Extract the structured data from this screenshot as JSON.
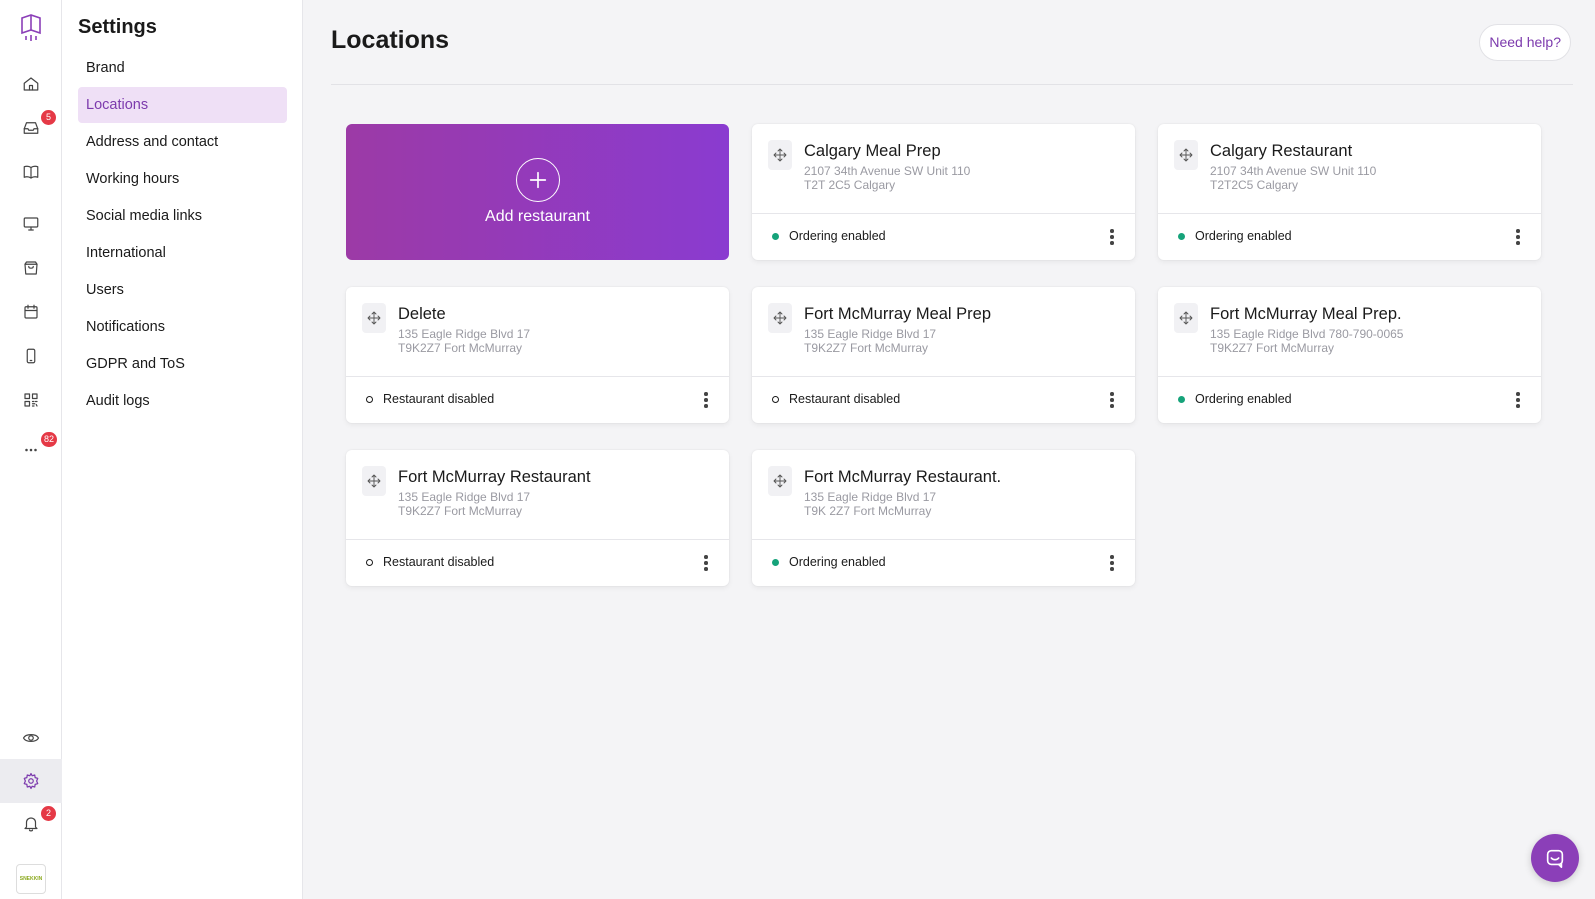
{
  "rail": {
    "inbox_badge": "5",
    "more_badge": "82",
    "notifications_badge": "2",
    "avatar_text": "SNEKKIN",
    "icons": [
      "logo-icon",
      "home-icon",
      "inbox-icon",
      "book-icon",
      "monitor-icon",
      "shopping-bag-icon",
      "calendar-icon",
      "mobile-icon",
      "qr-code-icon",
      "more-icon",
      "eye-icon",
      "gear-icon",
      "bell-icon"
    ]
  },
  "settings": {
    "title": "Settings",
    "items": [
      {
        "label": "Brand"
      },
      {
        "label": "Locations"
      },
      {
        "label": "Address and contact"
      },
      {
        "label": "Working hours"
      },
      {
        "label": "Social media links"
      },
      {
        "label": "International"
      },
      {
        "label": "Users"
      },
      {
        "label": "Notifications"
      },
      {
        "label": "GDPR and ToS"
      },
      {
        "label": "Audit logs"
      }
    ],
    "active_index": 1
  },
  "main": {
    "title": "Locations",
    "help_label": "Need help?",
    "add_label": "Add restaurant",
    "locations": [
      {
        "name": "Calgary Meal Prep",
        "address_line1": "2107 34th Avenue SW Unit 110",
        "address_line2": "T2T 2C5 Calgary",
        "status": "Ordering enabled",
        "enabled": true
      },
      {
        "name": "Calgary Restaurant",
        "address_line1": "2107 34th Avenue SW Unit 110",
        "address_line2": "T2T2C5 Calgary",
        "status": "Ordering enabled",
        "enabled": true
      },
      {
        "name": "Delete",
        "address_line1": "135 Eagle Ridge Blvd 17",
        "address_line2": "T9K2Z7 Fort McMurray",
        "status": "Restaurant disabled",
        "enabled": false
      },
      {
        "name": "Fort McMurray Meal Prep",
        "address_line1": "135 Eagle Ridge Blvd 17",
        "address_line2": "T9K2Z7 Fort McMurray",
        "status": "Restaurant disabled",
        "enabled": false
      },
      {
        "name": "Fort McMurray Meal Prep.",
        "address_line1": "135 Eagle Ridge Blvd 780-790-0065",
        "address_line2": "T9K2Z7 Fort McMurray",
        "status": "Ordering enabled",
        "enabled": true
      },
      {
        "name": "Fort McMurray Restaurant",
        "address_line1": "135 Eagle Ridge Blvd 17",
        "address_line2": "T9K2Z7 Fort McMurray",
        "status": "Restaurant disabled",
        "enabled": false
      },
      {
        "name": "Fort McMurray Restaurant.",
        "address_line1": "135 Eagle Ridge Blvd 17",
        "address_line2": "T9K 2Z7 Fort McMurray",
        "status": "Ordering enabled",
        "enabled": true
      }
    ]
  },
  "colors": {
    "accent": "#7c3aad",
    "active_nav_bg": "#efe0f6",
    "status_enabled": "#16a37a",
    "badge": "#e53946",
    "add_gradient_start": "#9c3aa6",
    "add_gradient_end": "#8a3bd0"
  }
}
